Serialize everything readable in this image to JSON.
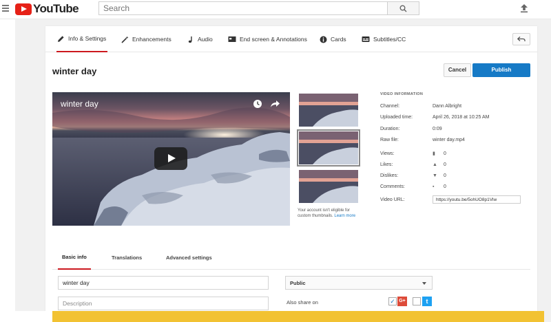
{
  "header": {
    "logo_text": "YouTube",
    "search_placeholder": "Search"
  },
  "tabs": [
    {
      "label": "Info & Settings",
      "icon": "pencil-icon",
      "active": true
    },
    {
      "label": "Enhancements",
      "icon": "magic-wand-icon"
    },
    {
      "label": "Audio",
      "icon": "music-note-icon"
    },
    {
      "label": "End screen & Annotations",
      "icon": "end-screen-icon"
    },
    {
      "label": "Cards",
      "icon": "info-circle-icon"
    },
    {
      "label": "Subtitles/CC",
      "icon": "subtitles-icon"
    }
  ],
  "page": {
    "title": "winter day",
    "cancel_label": "Cancel",
    "publish_label": "Publish"
  },
  "video": {
    "title": "winter day"
  },
  "thumbnails": {
    "note_text": "Your account isn't eligible for custom thumbnails.",
    "learn_more": "Learn more"
  },
  "info": {
    "heading": "VIDEO INFORMATION",
    "rows": [
      {
        "label": "Channel:",
        "value": "Dann Albright"
      },
      {
        "label": "Uploaded time:",
        "value": "April 26, 2018 at 10:25 AM"
      },
      {
        "label": "Duration:",
        "value": "0:09"
      },
      {
        "label": "Raw file:",
        "value": "winter day.mp4"
      }
    ],
    "stats": [
      {
        "label": "Views:",
        "value": "0",
        "icon": "bar-chart-icon"
      },
      {
        "label": "Likes:",
        "value": "0",
        "icon": "thumbs-up-icon"
      },
      {
        "label": "Dislikes:",
        "value": "0",
        "icon": "thumbs-down-icon"
      },
      {
        "label": "Comments:",
        "value": "0",
        "icon": "comment-icon"
      }
    ],
    "url_label": "Video URL:",
    "url_value": "https://youtu.be/5ohUO8p1Vlw"
  },
  "lower_tabs": [
    {
      "label": "Basic info",
      "active": true
    },
    {
      "label": "Translations"
    },
    {
      "label": "Advanced settings"
    }
  ],
  "form": {
    "title_value": "winter day",
    "description_placeholder": "Description",
    "privacy": "Public",
    "share_label": "Also share on"
  },
  "colors": {
    "brand_red": "#e62117",
    "accent_blue": "#167ac6",
    "tab_underline": "#cc181e",
    "bottom_bar": "#f2c232"
  }
}
